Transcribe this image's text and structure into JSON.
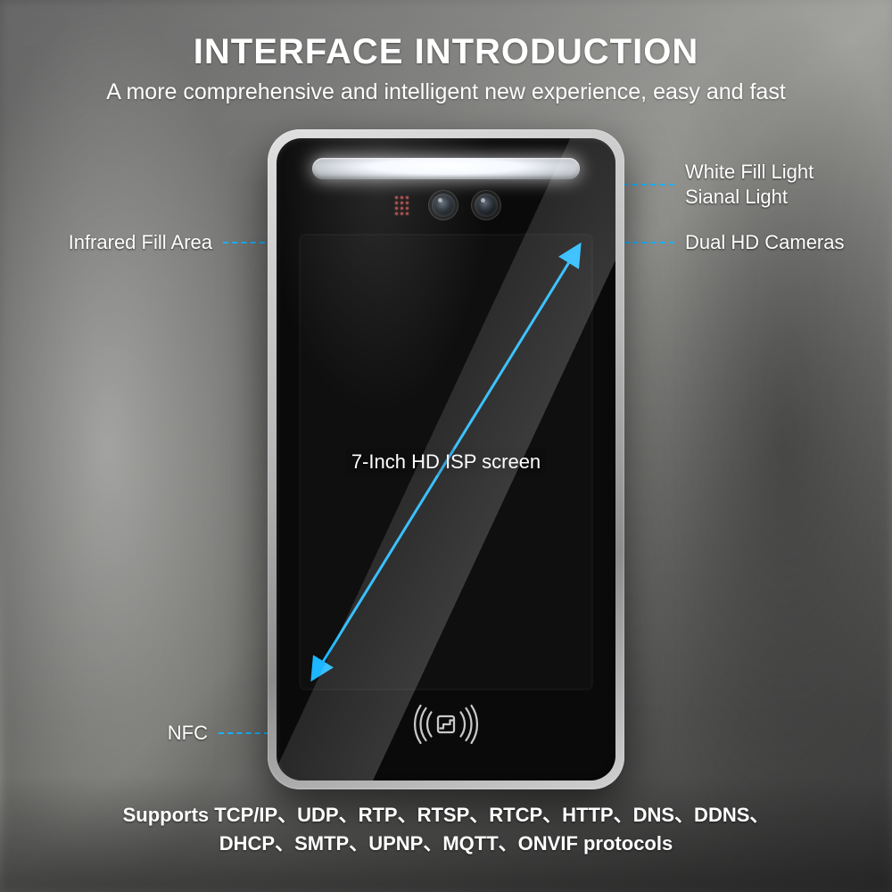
{
  "header": {
    "title": "INTERFACE INTRODUCTION",
    "subtitle": "A more comprehensive and intelligent new experience, easy and fast"
  },
  "annotations": {
    "fill_light_line1": "White Fill Light",
    "fill_light_line2": "Sianal Light",
    "infrared": "Infrared Fill Area",
    "cameras": "Dual HD Cameras",
    "nfc": "NFC",
    "screen": "7-Inch HD ISP screen"
  },
  "footer": {
    "line1": "Supports TCP/IP、UDP、RTP、RTSP、RTCP、HTTP、DNS、DDNS、",
    "line2": "DHCP、SMTP、UPNP、MQTT、ONVIF protocols"
  },
  "colors": {
    "accent": "#18b6ff"
  }
}
